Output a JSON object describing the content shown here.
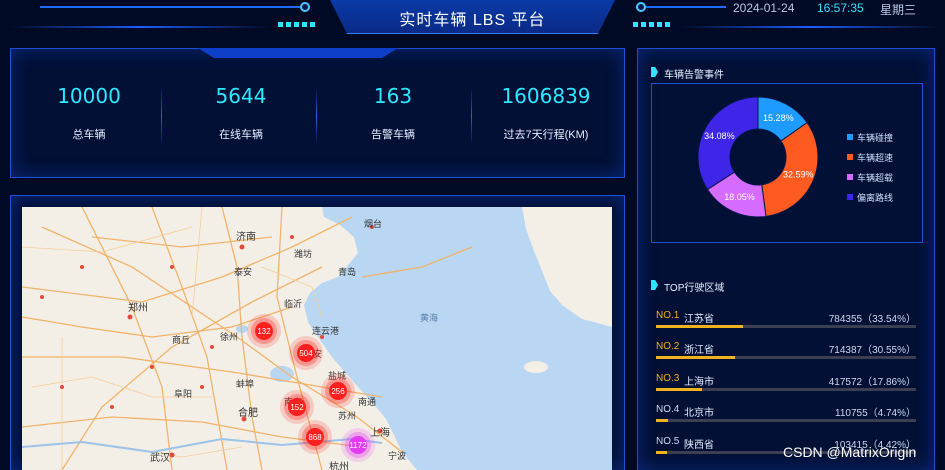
{
  "header": {
    "title": "实时车辆 LBS 平台",
    "date": "2024-01-24",
    "time": "16:57:35",
    "weekday": "星期三"
  },
  "stats": [
    {
      "value": "10000",
      "label": "总车辆"
    },
    {
      "value": "5644",
      "label": "在线车辆"
    },
    {
      "value": "163",
      "label": "告警车辆"
    },
    {
      "value": "1606839",
      "label": "过去7天行程(KM)"
    }
  ],
  "map": {
    "cities": [
      "济南",
      "郑州",
      "合肥",
      "武汉",
      "上海",
      "杭州",
      "连云港",
      "徐州",
      "淮安",
      "盐城",
      "南京",
      "苏州",
      "宁波",
      "临沂",
      "潍坊",
      "烟台",
      "青岛",
      "泰安",
      "商丘",
      "阜阳",
      "蚌埠",
      "南通"
    ],
    "sea_label": "黄海",
    "clusters": [
      {
        "count": "132",
        "color": "#ff1f1f"
      },
      {
        "count": "504",
        "color": "#ff1f1f"
      },
      {
        "count": "256",
        "color": "#ff1f1f"
      },
      {
        "count": "152",
        "color": "#ff1f1f"
      },
      {
        "count": "868",
        "color": "#ff1f1f"
      },
      {
        "count": "1172",
        "color": "#e23cf0"
      }
    ]
  },
  "alarm": {
    "title": "车辆告警事件",
    "slices": [
      {
        "label": "车辆碰撞",
        "value": 15.28,
        "text": "15.28%",
        "color": "#1e9bff"
      },
      {
        "label": "车辆超速",
        "value": 32.59,
        "text": "32.59%",
        "color": "#ff5a1f"
      },
      {
        "label": "车辆超载",
        "value": 18.05,
        "text": "18.05%",
        "color": "#d66bff"
      },
      {
        "label": "偏离路线",
        "value": 34.08,
        "text": "34.08%",
        "color": "#3f25e8"
      }
    ]
  },
  "ranking": {
    "title": "TOP行驶区域",
    "items": [
      {
        "no": "NO.1",
        "name": "江苏省",
        "value": "784355（33.54%）",
        "pct": 33.54
      },
      {
        "no": "NO.2",
        "name": "浙江省",
        "value": "714387（30.55%）",
        "pct": 30.55
      },
      {
        "no": "NO.3",
        "name": "上海市",
        "value": "417572（17.86%）",
        "pct": 17.86
      },
      {
        "no": "NO.4",
        "name": "北京市",
        "value": "110755（4.74%）",
        "pct": 4.74
      },
      {
        "no": "NO.5",
        "name": "陕西省",
        "value": "103415（4.42%）",
        "pct": 4.42
      }
    ]
  },
  "watermark": "CSDN @MatrixOrigin"
}
